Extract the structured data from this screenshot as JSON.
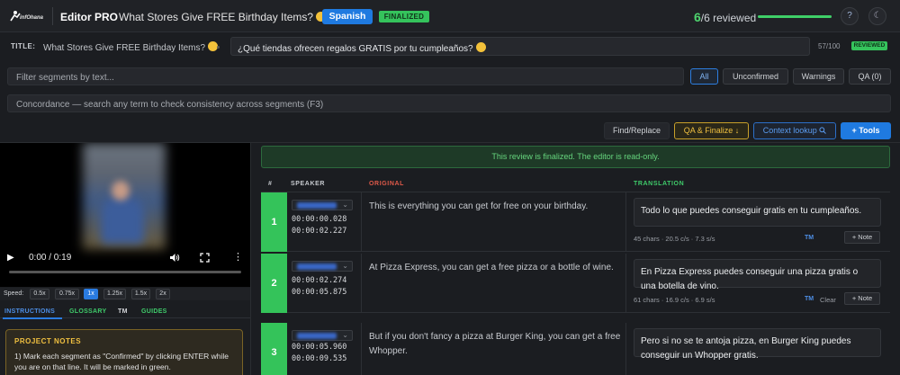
{
  "app": {
    "logo_text": "infOhana",
    "title": "Editor PRO",
    "doc_title": "What Stores Give FREE Birthday Items?",
    "language": "Spanish",
    "status_badge": "FINALIZED",
    "reviewed_done": "6",
    "reviewed_total": "/6 reviewed",
    "review_progress": 1.0,
    "help_label": "?",
    "theme_label": "☾"
  },
  "title_row": {
    "label": "TITLE:",
    "source": "What Stores Give FREE Birthday Items?",
    "translation": "¿Qué tiendas ofrecen regalos GRATIS por tu cumpleaños?",
    "char_count": "57/100",
    "badge": "REVIEWED"
  },
  "filter": {
    "placeholder": "Filter segments by text...",
    "buttons": [
      "All",
      "Unconfirmed",
      "Warnings",
      "QA (0)"
    ]
  },
  "concordance": {
    "placeholder": "Concordance — search any term to check consistency across segments (F3)"
  },
  "toolbar": {
    "find_replace": "Find/Replace",
    "qa_finalize": "QA & Finalize ↓",
    "context_lookup": "Context lookup",
    "tools": "+  Tools"
  },
  "player": {
    "time": "0:00 / 0:19",
    "speed_label": "Speed:",
    "speeds": [
      "0.5x",
      "0.75x",
      "1x",
      "1.25x",
      "1.5x",
      "2x"
    ],
    "active_speed": "1x"
  },
  "left_tabs": [
    "INSTRUCTIONS",
    "GLOSSARY",
    "TM",
    "GUIDES"
  ],
  "notes": {
    "heading": "PROJECT NOTES",
    "text": "1) Mark each segment as \"Confirmed\" by clicking ENTER while you are on that line. It will be marked in green."
  },
  "banner": "This review is finalized. The editor is read-only.",
  "table": {
    "headers": {
      "num": "#",
      "speaker": "SPEAKER",
      "original": "ORIGINAL",
      "translation": "TRANSLATION"
    },
    "rows": [
      {
        "num": "1",
        "start": "00:00:00.028",
        "end": "00:00:02.227",
        "original": "This is everything you can get for free on your birthday.",
        "translation": "Todo lo que puedes conseguir gratis en tu cumpleaños.",
        "meta": "45 chars · 20.5 c/s · 7.3 s/s",
        "tm": "TM",
        "clear": "",
        "note": "+ Note"
      },
      {
        "num": "2",
        "start": "00:00:02.274",
        "end": "00:00:05.875",
        "original": "At Pizza Express, you can get a free pizza or a bottle of wine.",
        "translation": "En Pizza Express puedes conseguir una pizza gratis o una botella de vino.",
        "meta": "61 chars · 16.9 c/s · 6.9 s/s",
        "tm": "TM",
        "clear": "Clear",
        "note": "+ Note"
      },
      {
        "num": "3",
        "start": "00:00:05.960",
        "end": "00:00:09.535",
        "original": "But if you don't fancy a pizza at Burger King, you can get a free Whopper.",
        "translation": "Pero si no se te antoja pizza, en Burger King puedes conseguir un Whopper gratis.",
        "meta": "",
        "tm": "",
        "clear": "",
        "note": ""
      }
    ]
  }
}
